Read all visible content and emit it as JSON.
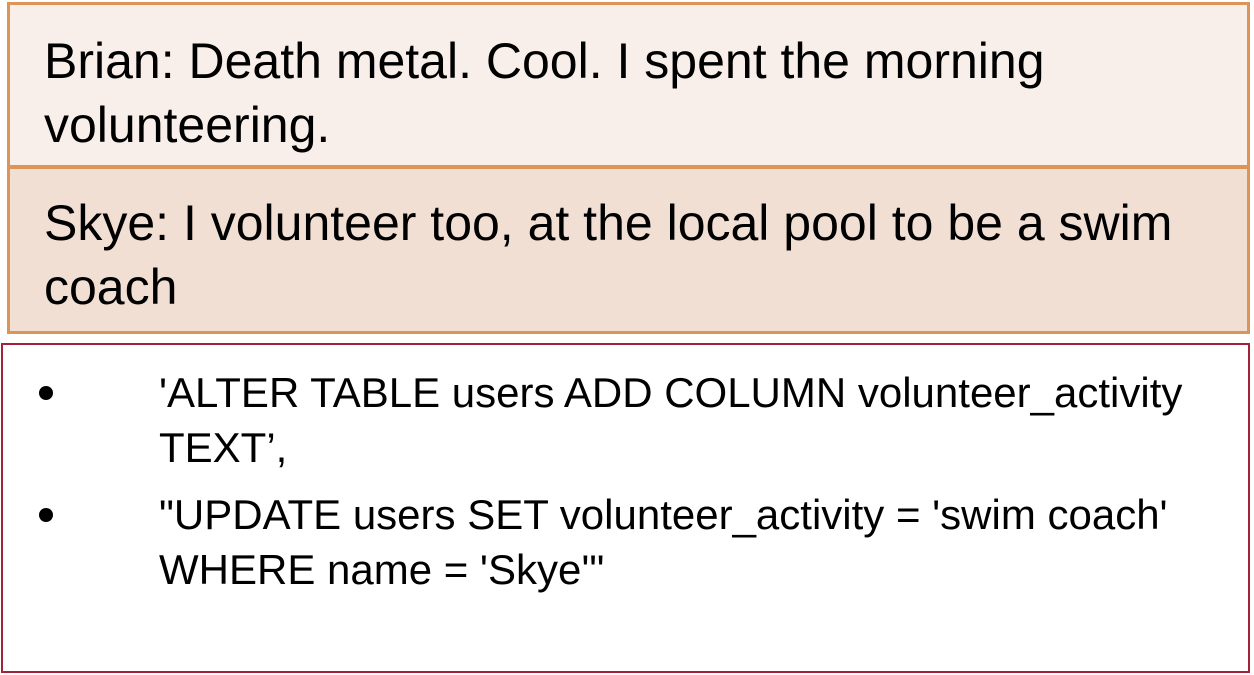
{
  "dialogue": [
    {
      "text": "Brian: Death metal. Cool. I spent the morning volunteering."
    },
    {
      "text": "Skye: I volunteer too, at the local pool to be a swim coach"
    }
  ],
  "sql_statements": [
    "'ALTER TABLE users ADD COLUMN volunteer_activity TEXT’,",
    "\"UPDATE users SET volunteer_activity = 'swim coach' WHERE name = 'Skye'\""
  ],
  "colors": {
    "dialogue_border": "#dd9457",
    "brian_background": "#f8eeea",
    "skye_background": "#f2dfd3",
    "sql_border": "#a0233a"
  }
}
